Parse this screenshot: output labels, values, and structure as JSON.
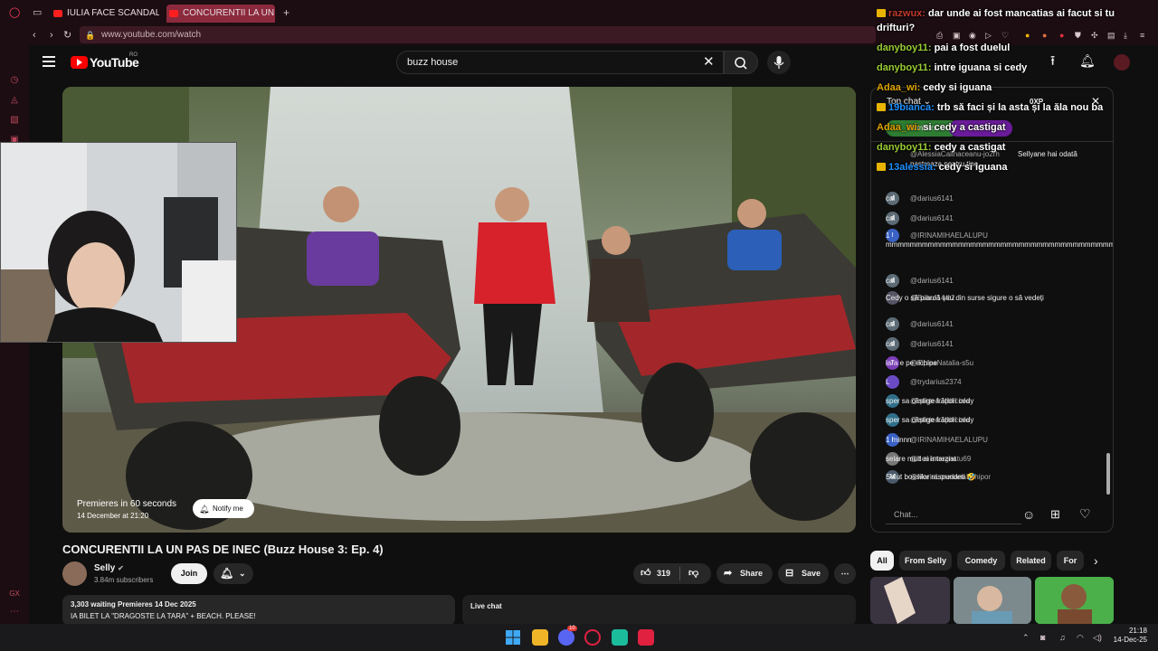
{
  "browser": {
    "tabs": [
      {
        "label": "IULIA FACE SCANDAL LA"
      },
      {
        "label": "CONCURENTII LA UN PAS"
      }
    ],
    "url": "www.youtube.com/watch"
  },
  "header": {
    "logo": "YouTube",
    "country": "RO",
    "search_value": "buzz house"
  },
  "video": {
    "premiere_text": "Premieres in 60 seconds",
    "premiere_date": "14 December at 21:20",
    "notify_label": "Notify me",
    "title": "CONCURENTII LA UN PAS DE INEC (Buzz House 3: Ep. 4)"
  },
  "channel": {
    "name": "Selly",
    "subscribers": "3.84m subscribers",
    "join_label": "Join"
  },
  "actions": {
    "likes": "319",
    "share_label": "Share",
    "save_label": "Save"
  },
  "description": {
    "stats": "3,303 waiting  Premieres 14 Dec 2025",
    "text": "IA BILET LA \"DRAGOSTE LA TARA\" + BEACH. PLEASE!"
  },
  "live_chat_box": {
    "title": "Live chat"
  },
  "yt_chat": {
    "mode": "Top chat",
    "points": "0XP",
    "tab_members": "Members",
    "top_partial_user": "@AlessiaCalinaceanu-jo2rh",
    "top_partial_text": "Sellyane hai odată",
    "top_partial_text2": "pastreaza pentru tine",
    "messages": [
      {
        "user": "@darius6141",
        "text": "cal",
        "initial": "d"
      },
      {
        "user": "@darius6141",
        "text": "cal",
        "initial": "d"
      },
      {
        "user": "@IRINAMIHAELALUPU",
        "text": "1 mmmmmmmmmmmmmmmmmmmmmmmmmmmmmmmmmmmmmmmmmmmmmmmmmmmmmmmmmmmmmmmmmmmmmmmmmmmmmmmmmmmmmmmmmmmmmmm",
        "initial": "I"
      },
      {
        "user": "@darius6141",
        "text": "cal",
        "initial": "d"
      },
      {
        "user": "@Bubu-14-c2",
        "text": "Cedy o să piardă știu din surse sigure o să vedeți",
        "initial": ""
      },
      {
        "user": "@darius6141",
        "text": "cal",
        "initial": "d"
      },
      {
        "user": "@darius6141",
        "text": "cal",
        "initial": "d"
      },
      {
        "user": "@TipleaNatalia-s5u",
        "text": "lara e pe echipe",
        "initial": "T"
      },
      {
        "user": "@trydarius2374",
        "text": "L",
        "initial": ""
      },
      {
        "user": "@mintea.artificiala",
        "text": "sper sa câștige frățiori cedy",
        "initial": ""
      },
      {
        "user": "@mintea.artificiala",
        "text": "sper sa câștige frățiori cedy",
        "initial": ""
      },
      {
        "user": "@IRINAMIHAELALUPU",
        "text": "1 minnn",
        "initial": "I"
      },
      {
        "user": "@denismagnatu69",
        "text": "selare mult ai intarziat",
        "initial": ""
      },
      {
        "user": "@MariaLoredanaSchipor",
        "text": "Salut bossilor raspundeti 🤣",
        "initial": "M"
      }
    ],
    "input_placeholder": "Chat..."
  },
  "overlay_chat": [
    {
      "user": "razwux",
      "text": "dar unde ai fost mancatias ai facut si tu",
      "badge": true,
      "color": "n1"
    },
    {
      "user": "",
      "text": "drifturi?",
      "badge": false,
      "color": "n1"
    },
    {
      "user": "danyboy11",
      "text": "pai a fost duelul",
      "badge": false,
      "color": "n2"
    },
    {
      "user": "danyboy11",
      "text": "intre iguana si cedy",
      "badge": false,
      "color": "n2"
    },
    {
      "user": "Adaa_wi",
      "text": "cedy si iguana",
      "badge": false,
      "color": "n3"
    },
    {
      "user": "19bianca",
      "text": "trb să faci și la asta și la ăla nou ba",
      "badge": true,
      "color": "n4"
    },
    {
      "user": "Adaa_wi",
      "text": "si cedy a castigat",
      "badge": false,
      "color": "n3"
    },
    {
      "user": "danyboy11",
      "text": "cedy a castigat",
      "badge": false,
      "color": "n2"
    },
    {
      "user": "13alessia",
      "text": "cedy si iguana",
      "badge": true,
      "color": "n4"
    }
  ],
  "chips": [
    "All",
    "From Selly",
    "Comedy",
    "Related",
    "For"
  ],
  "taskbar": {
    "time": "21:18",
    "date": "14-Dec-25",
    "badge_count": "10"
  },
  "colors": {
    "accent": "#ff0000",
    "browser_bg": "#1c0d12",
    "page_bg": "#0f0f0f"
  }
}
